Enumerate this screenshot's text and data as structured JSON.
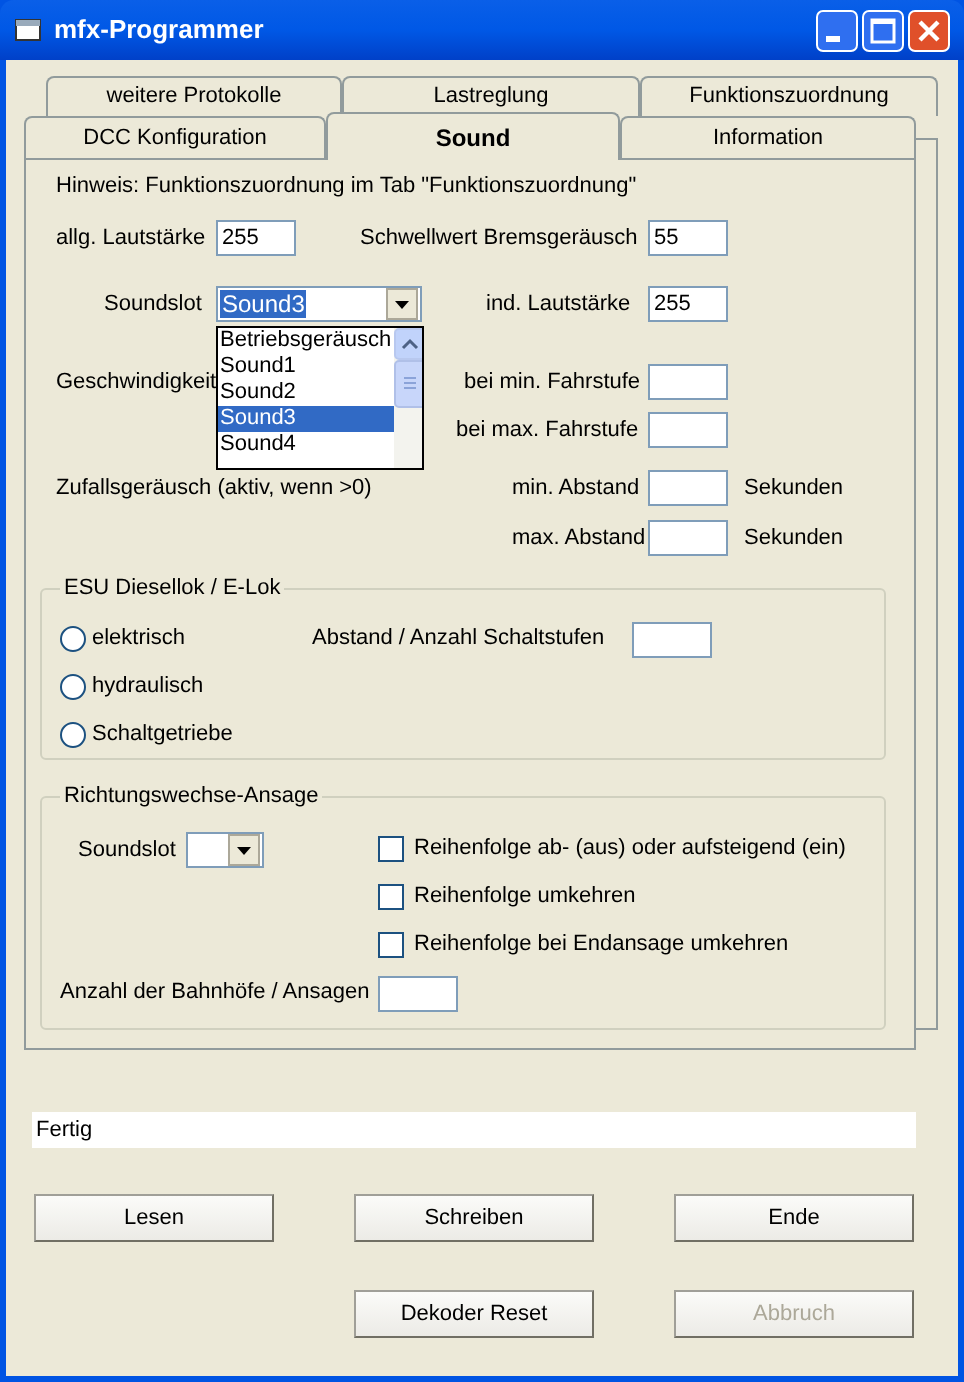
{
  "window": {
    "title": "mfx-Programmer"
  },
  "tabs_back": [
    {
      "label": "weitere Protokolle",
      "selected": false
    },
    {
      "label": "Lastreglung",
      "selected": false
    },
    {
      "label": "Funktionszuordnung",
      "selected": false
    }
  ],
  "tabs_front": [
    {
      "label": "DCC Konfiguration",
      "selected": false
    },
    {
      "label": "Sound",
      "selected": true
    },
    {
      "label": "Information",
      "selected": false
    }
  ],
  "hint": "Hinweis: Funktionszuordnung im Tab \"Funktionszuordnung\"",
  "general_volume": {
    "label": "allg. Lautstärke",
    "value": "255"
  },
  "brake_threshold": {
    "label": "Schwellwert Bremsgeräusch",
    "value": "55"
  },
  "soundslot": {
    "label": "Soundslot",
    "value": "Sound3",
    "expanded": true,
    "options": [
      {
        "label": "Betriebsgeräusch",
        "selected": false
      },
      {
        "label": "Sound1",
        "selected": false
      },
      {
        "label": "Sound2",
        "selected": false
      },
      {
        "label": "Sound3",
        "selected": true
      },
      {
        "label": "Sound4",
        "selected": false
      }
    ]
  },
  "individual_volume": {
    "label": "ind. Lautstärke",
    "value": "255"
  },
  "speed_label": "Geschwindigkeit",
  "min_step": {
    "label": "bei min. Fahrstufe"
  },
  "max_step": {
    "label": "bei max. Fahrstufe"
  },
  "random_label": "Zufallsgeräusch (aktiv, wenn >0)",
  "min_distance": {
    "label": "min. Abstand",
    "unit": "Sekunden"
  },
  "max_distance": {
    "label": "max. Abstand",
    "unit": "Sekunden"
  },
  "esu_group": {
    "title": "ESU Diesellok / E-Lok",
    "radios": [
      {
        "label": "elektrisch",
        "selected": false
      },
      {
        "label": "hydraulisch",
        "selected": false
      },
      {
        "label": "Schaltgetriebe",
        "selected": false
      }
    ],
    "steps": {
      "label": "Abstand / Anzahl Schaltstufen"
    }
  },
  "announce_group": {
    "title": "Richtungswechse-Ansage",
    "soundslot": {
      "label": "Soundslot"
    },
    "checkboxes": [
      {
        "label": "Reihenfolge ab- (aus) oder aufsteigend (ein)",
        "checked": false
      },
      {
        "label": "Reihenfolge umkehren",
        "checked": false
      },
      {
        "label": "Reihenfolge bei Endansage umkehren",
        "checked": false
      }
    ],
    "stations": {
      "label": "Anzahl der Bahnhöfe / Ansagen"
    }
  },
  "status": "Fertig",
  "buttons_row1": [
    {
      "label": "Lesen",
      "disabled": false
    },
    {
      "label": "Schreiben",
      "disabled": false
    },
    {
      "label": "Ende",
      "disabled": false
    }
  ],
  "buttons_row2": [
    {
      "label": "Dekoder Reset",
      "disabled": false
    },
    {
      "label": "Abbruch",
      "disabled": true
    }
  ]
}
